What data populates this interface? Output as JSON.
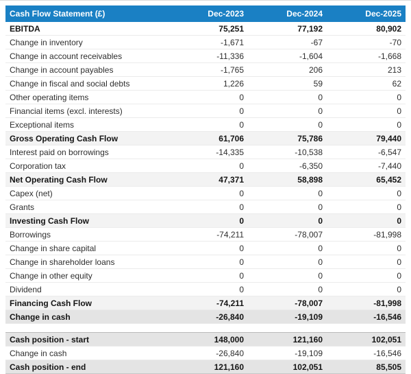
{
  "table": {
    "title": "Cash Flow Statement (£)",
    "columns": [
      "Dec-2023",
      "Dec-2024",
      "Dec-2025"
    ],
    "colors": {
      "header_bg": "#1a80c4",
      "header_text": "#ffffff",
      "total_row_bg": "#f3f3f3",
      "summary_row_bg": "#e4e4e4",
      "row_border": "#ebebeb",
      "strong_border": "#b9b9b9",
      "text": "#2e2e2e",
      "bold_text": "#141414"
    },
    "rows": [
      {
        "label": "EBITDA",
        "values": [
          "75,251",
          "77,192",
          "80,902"
        ],
        "style": "bold"
      },
      {
        "label": "Change in inventory",
        "values": [
          "-1,671",
          "-67",
          "-70"
        ],
        "style": "normal"
      },
      {
        "label": "Change in account receivables",
        "values": [
          "-11,336",
          "-1,604",
          "-1,668"
        ],
        "style": "normal"
      },
      {
        "label": "Change in account payables",
        "values": [
          "-1,765",
          "206",
          "213"
        ],
        "style": "normal"
      },
      {
        "label": "Change in fiscal and social debts",
        "values": [
          "1,226",
          "59",
          "62"
        ],
        "style": "normal"
      },
      {
        "label": "Other operating items",
        "values": [
          "0",
          "0",
          "0"
        ],
        "style": "normal"
      },
      {
        "label": "Financial items (excl. interests)",
        "values": [
          "0",
          "0",
          "0"
        ],
        "style": "normal"
      },
      {
        "label": "Exceptional items",
        "values": [
          "0",
          "0",
          "0"
        ],
        "style": "normal"
      },
      {
        "label": "Gross Operating Cash Flow",
        "values": [
          "61,706",
          "75,786",
          "79,440"
        ],
        "style": "total"
      },
      {
        "label": "Interest paid on borrowings",
        "values": [
          "-14,335",
          "-10,538",
          "-6,547"
        ],
        "style": "normal"
      },
      {
        "label": "Corporation tax",
        "values": [
          "0",
          "-6,350",
          "-7,440"
        ],
        "style": "normal"
      },
      {
        "label": "Net Operating Cash Flow",
        "values": [
          "47,371",
          "58,898",
          "65,452"
        ],
        "style": "total"
      },
      {
        "label": "Capex (net)",
        "values": [
          "0",
          "0",
          "0"
        ],
        "style": "normal"
      },
      {
        "label": "Grants",
        "values": [
          "0",
          "0",
          "0"
        ],
        "style": "normal"
      },
      {
        "label": "Investing Cash Flow",
        "values": [
          "0",
          "0",
          "0"
        ],
        "style": "total"
      },
      {
        "label": "Borrowings",
        "values": [
          "-74,211",
          "-78,007",
          "-81,998"
        ],
        "style": "normal"
      },
      {
        "label": "Change in share capital",
        "values": [
          "0",
          "0",
          "0"
        ],
        "style": "normal"
      },
      {
        "label": "Change in shareholder loans",
        "values": [
          "0",
          "0",
          "0"
        ],
        "style": "normal"
      },
      {
        "label": "Change in other equity",
        "values": [
          "0",
          "0",
          "0"
        ],
        "style": "normal"
      },
      {
        "label": "Dividend",
        "values": [
          "0",
          "0",
          "0"
        ],
        "style": "normal"
      },
      {
        "label": "Financing Cash Flow",
        "values": [
          "-74,211",
          "-78,007",
          "-81,998"
        ],
        "style": "total"
      },
      {
        "label": "Change in cash",
        "values": [
          "-26,840",
          "-19,109",
          "-16,546"
        ],
        "style": "summary"
      },
      {
        "label": "Cash position - start",
        "values": [
          "148,000",
          "121,160",
          "102,051"
        ],
        "style": "summary",
        "gap_before": true
      },
      {
        "label": "Change in cash",
        "values": [
          "-26,840",
          "-19,109",
          "-16,546"
        ],
        "style": "normal"
      },
      {
        "label": "Cash position - end",
        "values": [
          "121,160",
          "102,051",
          "85,505"
        ],
        "style": "summary"
      }
    ]
  }
}
